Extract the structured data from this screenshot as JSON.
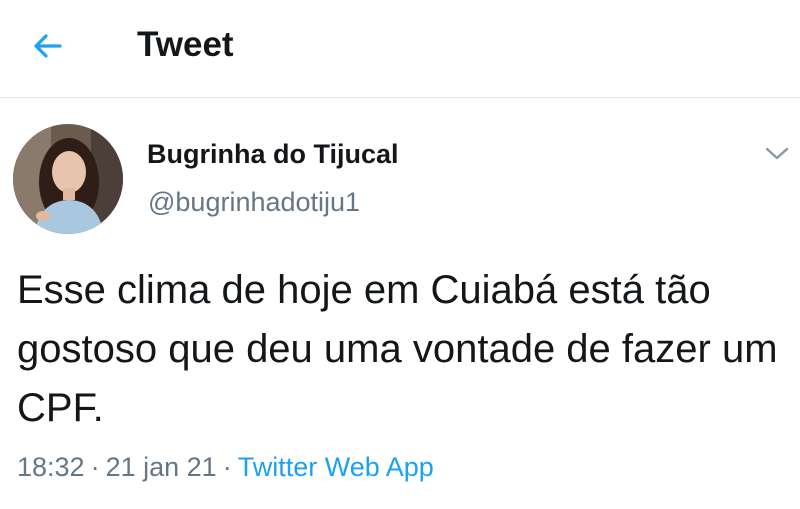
{
  "header": {
    "title": "Tweet"
  },
  "tweet": {
    "author_name": "Bugrinha do Tijucal",
    "author_handle": "@bugrinhadotiju1",
    "text": "Esse clima de hoje em Cuiabá está tão gostoso que deu uma vontade de fazer um CPF.",
    "time": "18:32",
    "date": "21 jan 21",
    "separator": "·",
    "source": "Twitter Web App"
  },
  "icons": {
    "back": "arrow-left-icon",
    "menu": "chevron-down-icon"
  },
  "colors": {
    "accent": "#1da1f2",
    "text_primary": "#14171a",
    "text_secondary": "#657786",
    "divider": "#e1e6ea"
  }
}
